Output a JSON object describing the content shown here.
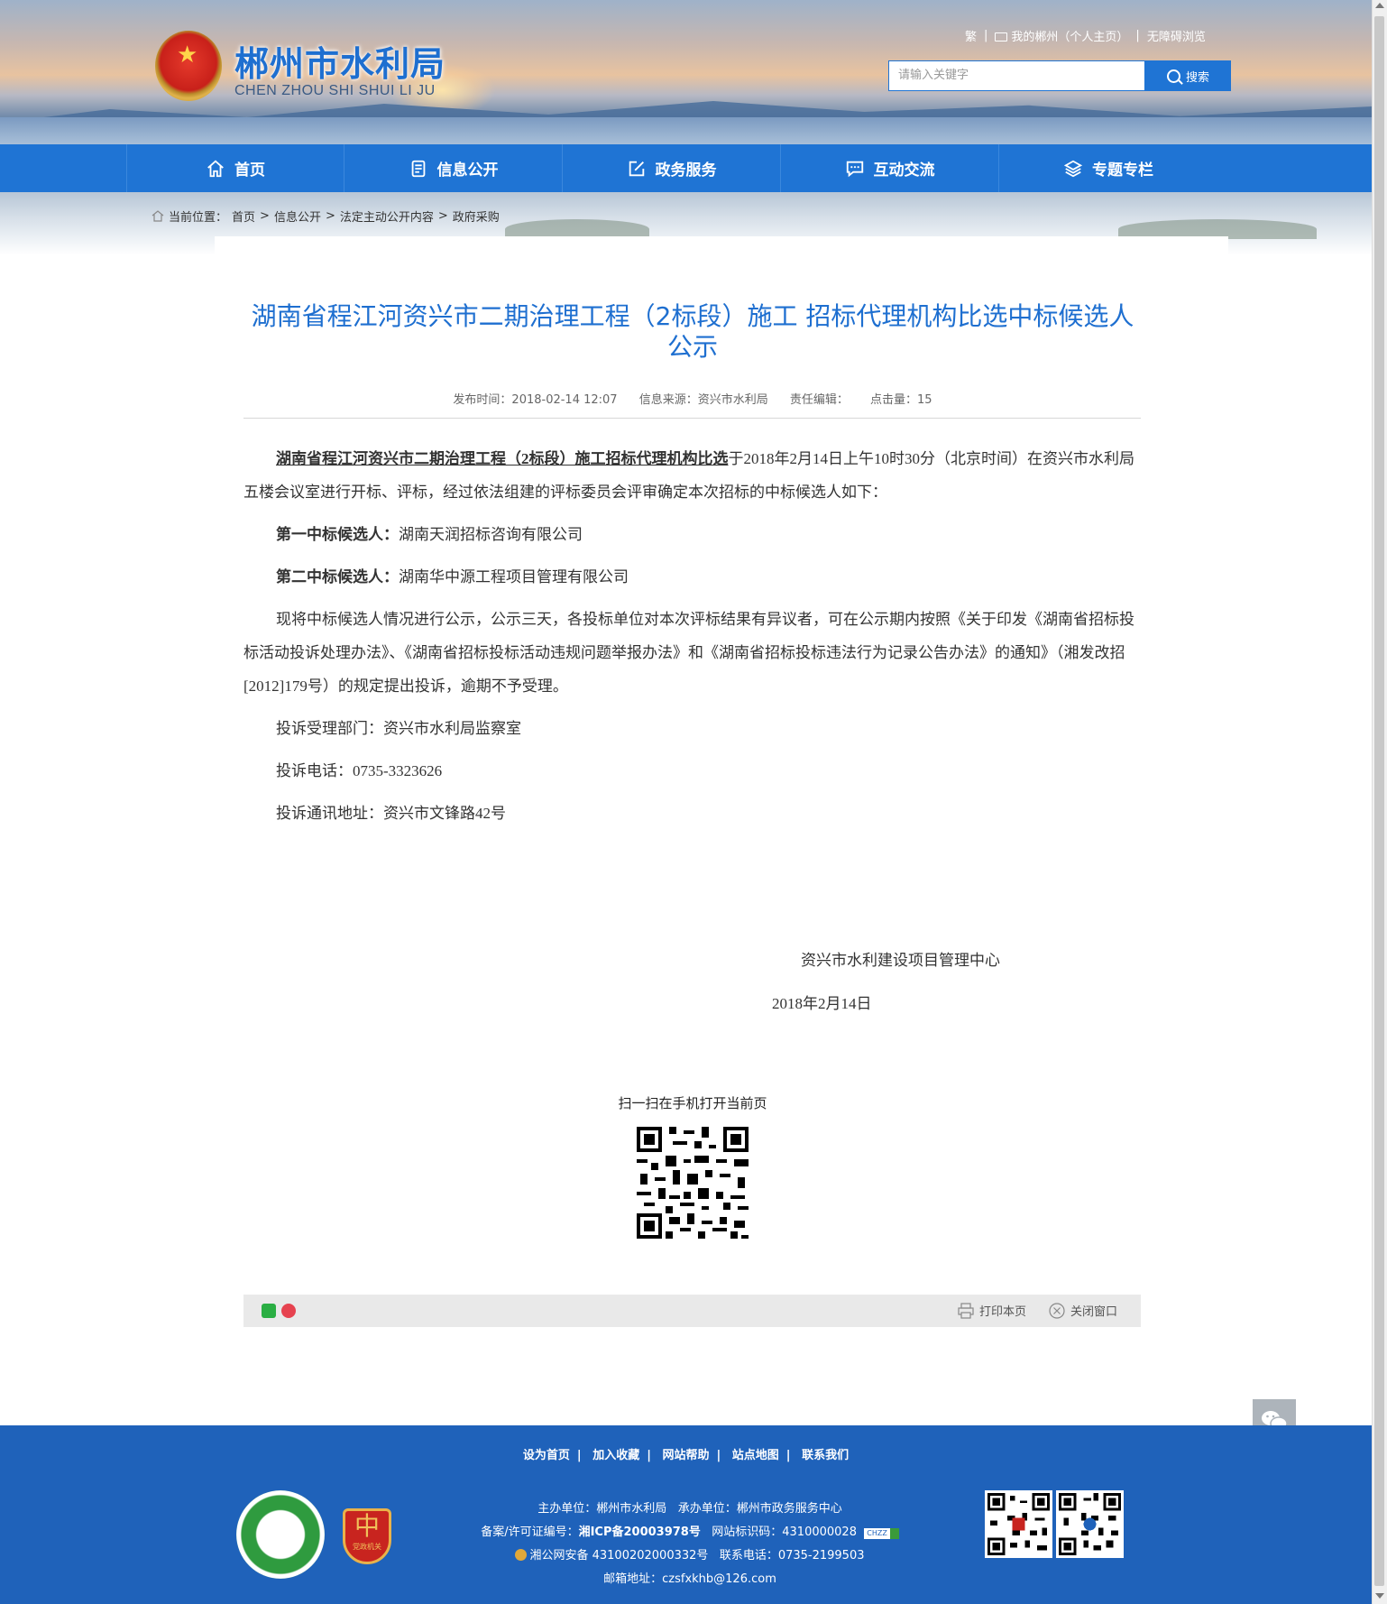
{
  "header": {
    "site_title": "郴州市水利局",
    "site_subtitle": "CHEN ZHOU SHI SHUI LI JU",
    "top_links": {
      "traditional": "繁",
      "my_chenzhou": "我的郴州（个人主页）",
      "accessible": "无障碍浏览"
    },
    "search": {
      "placeholder": "请输入关键字",
      "button_label": "搜索"
    }
  },
  "nav": {
    "items": [
      {
        "label": "首页",
        "icon": "home-icon"
      },
      {
        "label": "信息公开",
        "icon": "document-icon"
      },
      {
        "label": "政务服务",
        "icon": "edit-icon"
      },
      {
        "label": "互动交流",
        "icon": "chat-icon"
      },
      {
        "label": "专题专栏",
        "icon": "layers-icon"
      }
    ]
  },
  "breadcrumb": {
    "prefix": "当前位置：",
    "items": [
      "首页",
      "信息公开",
      "法定主动公开内容",
      "政府采购"
    ],
    "separator": ">"
  },
  "article": {
    "title": "湖南省程江河资兴市二期治理工程（2标段）施工 招标代理机构比选中标候选人公示",
    "meta": {
      "published": "发布时间：2018-02-14 12:07",
      "source": "信息来源：资兴市水利局",
      "editor": "责任编辑：",
      "clicks": "点击量：15"
    },
    "p1_bold": "湖南省程江河资兴市二期治理工程（2标段）施工招标代理机构比选",
    "p1_rest": "于2018年2月14日上午10时30分（北京时间）在资兴市水利局五楼会议室进行开标、评标，经过依法组建的评标委员会评审确定本次招标的中标候选人如下：",
    "first_label": "第一中标候选人：",
    "first_value": "湖南天润招标咨询有限公司",
    "second_label": "第二中标候选人：",
    "second_value": "湖南华中源工程项目管理有限公司",
    "p_notice": "现将中标候选人情况进行公示，公示三天，各投标单位对本次评标结果有异议者，可在公示期内按照《关于印发《湖南省招标投标活动投诉处理办法》、《湖南省招标投标活动违规问题举报办法》和《湖南省招标投标违法行为记录公告办法》的通知》（湘发改招[2012]179号）的规定提出投诉，逾期不予受理。",
    "complaint_dept": "投诉受理部门：资兴市水利局监察室",
    "complaint_phone": "投诉电话：0735-3323626",
    "complaint_addr": "投诉通讯地址：资兴市文锋路42号",
    "signoff_org": "资兴市水利建设项目管理中心",
    "signoff_date": "2018年2月14日",
    "qr_caption": "扫一扫在手机打开当前页"
  },
  "share_bar": {
    "print_label": "打印本页",
    "close_label": "关闭窗口"
  },
  "footer": {
    "links": [
      "设为首页",
      "加入收藏",
      "网站帮助",
      "站点地图",
      "联系我们"
    ],
    "host": "主办单位：郴州市水利局",
    "undertaker": "承办单位：郴州市政务服务中心",
    "icp_prefix": "备案/许可证编号：",
    "icp": "湘ICP备20003978号",
    "site_code": "网站标识码：4310000028",
    "police": "湘公网安备 43100202000332号",
    "phone": "联系电话：0735-2199503",
    "email": "邮箱地址：czsfxkhb@126.com",
    "badge_red_text": "党政机关",
    "ch_badge": "CHZZ"
  },
  "colors": {
    "primary": "#1f74d4",
    "footer": "#1f62ba",
    "title": "#1e6fd0"
  }
}
